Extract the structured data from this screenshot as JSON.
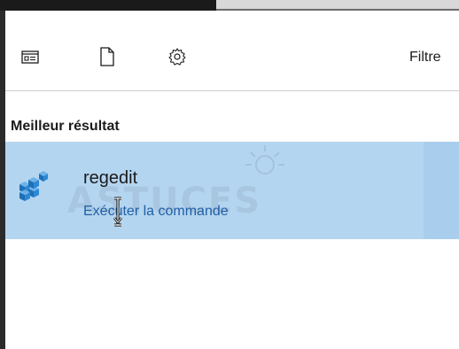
{
  "toolbar": {
    "icons": [
      "apps-icon",
      "document-icon",
      "gear-icon"
    ],
    "filter_label": "Filtre"
  },
  "section": {
    "heading": "Meilleur résultat"
  },
  "best_result": {
    "name": "regedit",
    "action": "Exécuter la commande",
    "icon": "registry-cubes-icon"
  },
  "watermark": {
    "text": "ASTUCES"
  },
  "colors": {
    "selection": "#b4d5f0",
    "link": "#1f5fa6"
  }
}
